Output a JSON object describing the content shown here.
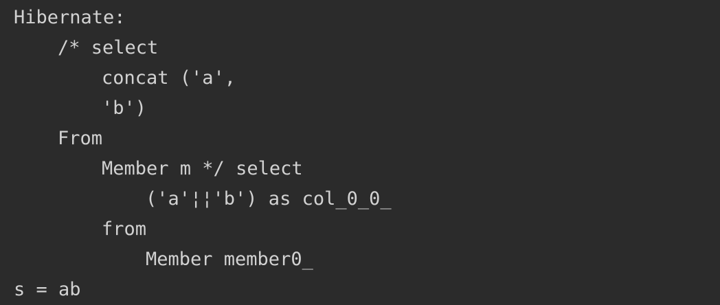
{
  "console": {
    "lines": [
      "Hibernate:",
      "/* select",
      "concat ('a',",
      "'b')",
      "From",
      "Member m */ select",
      "('a'¦¦'b') as col_0_0_",
      "from",
      "Member member0_",
      "s = ab"
    ]
  },
  "colors": {
    "background": "#2b2b2b",
    "text": "#d2d2d2"
  }
}
